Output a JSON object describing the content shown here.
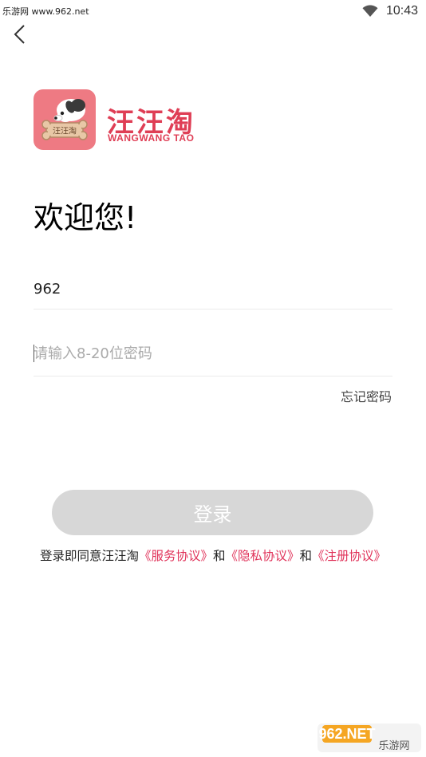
{
  "status_bar": {
    "left_text": "乐游网 www.962.net",
    "time": "10:43",
    "icons": [
      "wifi-icon"
    ]
  },
  "header": {
    "back_icon": "chevron-left-icon"
  },
  "logo": {
    "cn": "汪汪淘",
    "en": "WANGWANG TAO",
    "badge_text": "汪汪淘"
  },
  "welcome": "欢迎您!",
  "form": {
    "phone_value": "962",
    "password_placeholder": "请输入8-20位密码",
    "forgot_label": "忘记密码",
    "login_label": "登录"
  },
  "agreement": {
    "prefix": "登录即同意汪汪淘",
    "service": "《服务协议》",
    "and1": "和",
    "privacy": "《隐私协议》",
    "and2": "和",
    "register": "《注册协议》"
  },
  "watermark": {
    "top": "962.NET",
    "bottom": "乐游网"
  },
  "colors": {
    "brand": "#df3e55",
    "link": "#e0335a",
    "button_disabled": "#d7d7d7"
  }
}
